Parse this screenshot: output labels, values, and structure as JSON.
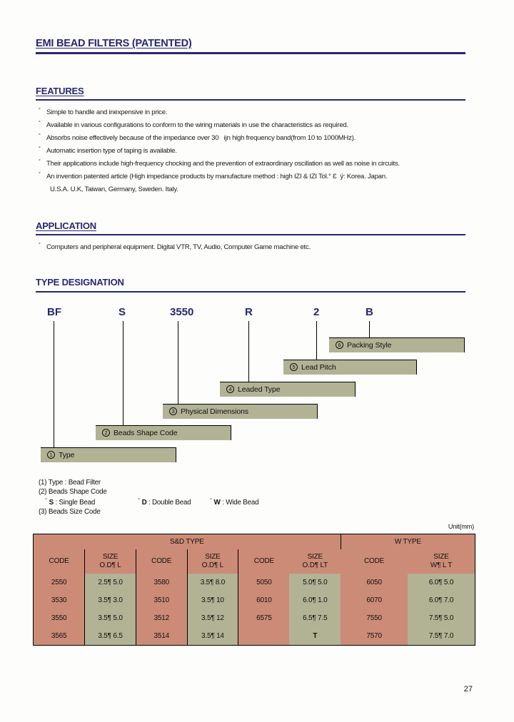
{
  "document": {
    "title": "EMI BEAD FILTERS (PATENTED)",
    "page_number": "27",
    "unit_note": "Unit(mm)",
    "accent_color": "#262673",
    "table_header_color": "#cc8b76",
    "table_size_cell_color": "#b2b295"
  },
  "sections": {
    "features": {
      "heading": "FEATURES",
      "items": [
        "Simple to handle and inexpensive in price.",
        "Available in various configurations to conform to the wiring materials in use the characteristics as required.",
        "Absorbs noise effectively because of the impedance over 30   ĳn high frequency band(from 10 to 1000MHz).",
        "Automatic insertion type of taping is available.",
        "Their applications include high-frequency chocking and the prevention of extraordinary oscillation as well as noise in circuits.",
        "An invention patented article (High impedance products by manufacture method : high IZI & IZI Tol.°  Ɛ  ÿ: Korea. Japan."
      ],
      "continuation": "U.S.A. U.K, Taiwan, Germany, Sweden. Italy."
    },
    "application": {
      "heading": "APPLICATION",
      "items": [
        "Computers and peripheral equipment. Digital VTR, TV, Audio, Computer Game machine etc."
      ]
    },
    "type_designation": {
      "heading": "TYPE DESIGNATION",
      "code_tokens": [
        "BF",
        "S",
        "3550",
        "R",
        "2",
        "B"
      ],
      "callouts": [
        {
          "num": "6",
          "label": "Packing Style"
        },
        {
          "num": "5",
          "label": "Lead Pitch"
        },
        {
          "num": "4",
          "label": "Leaded Type"
        },
        {
          "num": "3",
          "label": "Physical Dimensions"
        },
        {
          "num": "2",
          "label": "Beads Shape Code"
        },
        {
          "num": "1",
          "label": "Type"
        }
      ],
      "legend": {
        "line1": "(1) Type : Bead Filter",
        "line2": "(2) Beads Shape Code",
        "shape_codes": [
          {
            "code": "S",
            "desc": ": Single Bead"
          },
          {
            "code": "D",
            "desc": ": Double Bead"
          },
          {
            "code": "W",
            "desc": ": Wide Bead"
          }
        ],
        "line4": "(3) Beads Size Code"
      }
    }
  },
  "size_table": {
    "group_headers": [
      "S&D TYPE",
      "W TYPE"
    ],
    "column_headers": [
      {
        "l1": "CODE",
        "l2": ""
      },
      {
        "l1": "SIZE",
        "l2": "O.D¶ L"
      },
      {
        "l1": "CODE",
        "l2": ""
      },
      {
        "l1": "SIZE",
        "l2": "O.D¶ L"
      },
      {
        "l1": "CODE",
        "l2": ""
      },
      {
        "l1": "SIZE",
        "l2": "O.D¶ LT"
      },
      {
        "l1": "CODE",
        "l2": ""
      },
      {
        "l1": "SIZE",
        "l2": "W¶ L T"
      }
    ],
    "rows": [
      [
        "2550",
        "2.5¶ 5.0",
        "3580",
        "3.5¶ 8.0",
        "5050",
        "5.0¶ 5.0",
        "6050",
        "6.0¶ 5.0"
      ],
      [
        "3530",
        "3.5¶ 3.0",
        "3510",
        "3.5¶ 10",
        "6010",
        "6.0¶ 1.0",
        "6070",
        "6.0¶ 7.0"
      ],
      [
        "3550",
        "3.5¶ 5.0",
        "3512",
        "3.5¶ 12",
        "6575",
        "6.5¶ 7.5",
        "7550",
        "7.5¶ 5.0"
      ],
      [
        "3565",
        "3.5¶ 6.5",
        "3514",
        "3.5¶ 14",
        "",
        "T",
        "7570",
        "7.5¶ 7.0"
      ]
    ]
  }
}
